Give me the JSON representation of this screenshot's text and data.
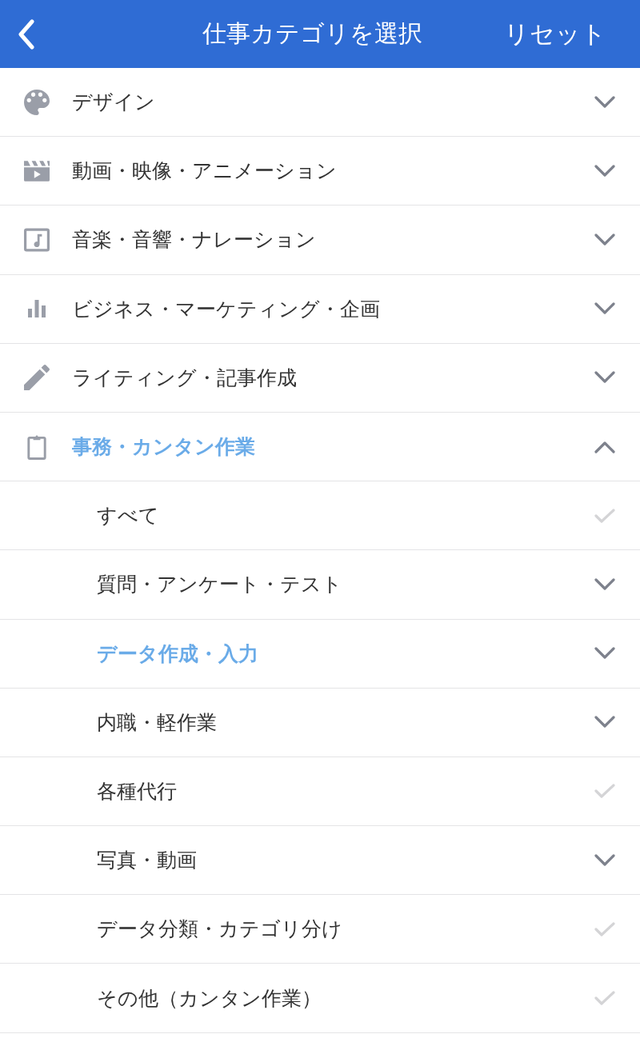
{
  "header": {
    "title": "仕事カテゴリを選択",
    "reset_label": "リセット"
  },
  "categories": [
    {
      "label": "デザイン",
      "selected": false,
      "expanded": false
    },
    {
      "label": "動画・映像・アニメーション",
      "selected": false,
      "expanded": false
    },
    {
      "label": "音楽・音響・ナレーション",
      "selected": false,
      "expanded": false
    },
    {
      "label": "ビジネス・マーケティング・企画",
      "selected": false,
      "expanded": false
    },
    {
      "label": "ライティング・記事作成",
      "selected": false,
      "expanded": false
    },
    {
      "label": "事務・カンタン作業",
      "selected": true,
      "expanded": true,
      "children": [
        {
          "label": "すべて",
          "kind": "option",
          "selected": false,
          "checked": false
        },
        {
          "label": "質問・アンケート・テスト",
          "kind": "group",
          "selected": false,
          "expanded": false
        },
        {
          "label": "データ作成・入力",
          "kind": "group",
          "selected": true,
          "expanded": false
        },
        {
          "label": "内職・軽作業",
          "kind": "group",
          "selected": false,
          "expanded": false
        },
        {
          "label": "各種代行",
          "kind": "option",
          "selected": false,
          "checked": false
        },
        {
          "label": "写真・動画",
          "kind": "group",
          "selected": false,
          "expanded": false
        },
        {
          "label": "データ分類・カテゴリ分け",
          "kind": "option",
          "selected": false,
          "checked": false
        },
        {
          "label": "その他（カンタン作業）",
          "kind": "option",
          "selected": false,
          "checked": false
        }
      ]
    }
  ]
}
